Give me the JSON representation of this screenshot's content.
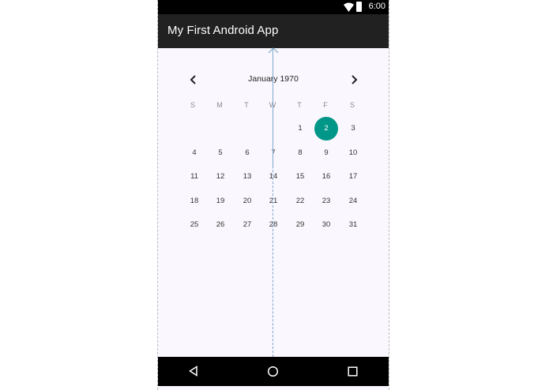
{
  "status_bar": {
    "time": "6:00",
    "icons": [
      "wifi-icon",
      "battery-icon"
    ]
  },
  "app_bar": {
    "title": "My First Android App"
  },
  "calendar": {
    "month_label": "January 1970",
    "weekday_labels": [
      "S",
      "M",
      "T",
      "W",
      "T",
      "F",
      "S"
    ],
    "weeks": [
      [
        "",
        "",
        "",
        "",
        "1",
        "2",
        "3"
      ],
      [
        "4",
        "5",
        "6",
        "7",
        "8",
        "9",
        "10"
      ],
      [
        "11",
        "12",
        "13",
        "14",
        "15",
        "16",
        "17"
      ],
      [
        "18",
        "19",
        "20",
        "21",
        "22",
        "23",
        "24"
      ],
      [
        "25",
        "26",
        "27",
        "28",
        "29",
        "30",
        "31"
      ]
    ],
    "selected_day": "2",
    "accent_color": "#009688"
  },
  "nav_bar": {
    "icons": [
      "back-icon",
      "home-icon",
      "recents-icon"
    ]
  }
}
